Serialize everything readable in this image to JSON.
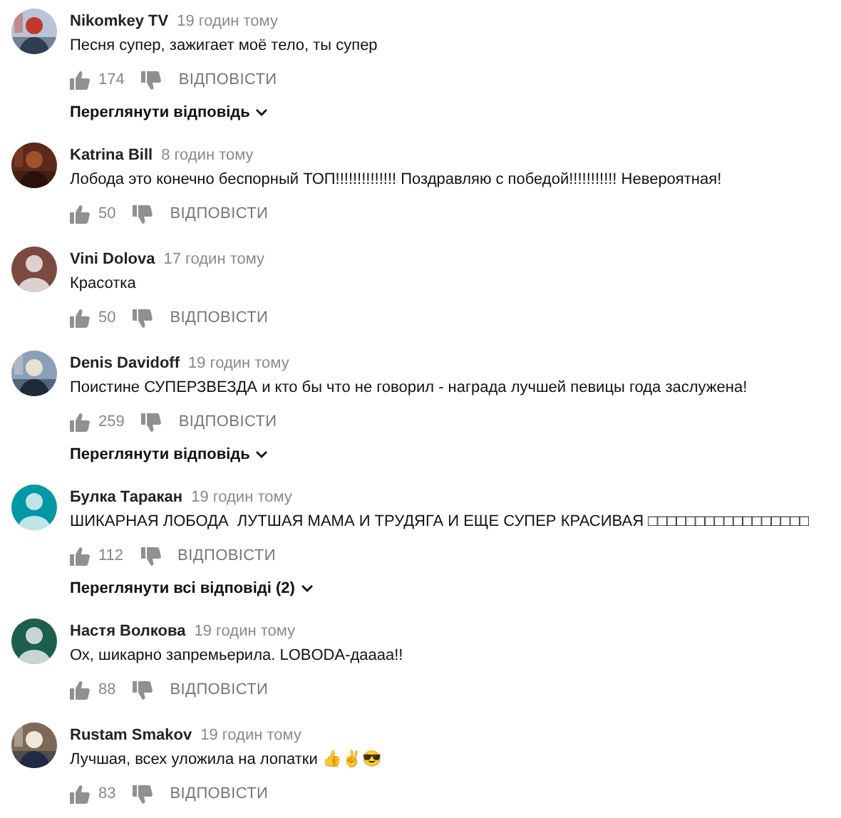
{
  "comments": [
    {
      "author": "Nikomkey TV",
      "time": "19 годин тому",
      "text": "Песня супер, зажигает моё тело, ты супер",
      "likes": "174",
      "reply_label": "ВІДПОВІСТИ",
      "replies_link": "Переглянути відповідь"
    },
    {
      "author": "Katrina Bill",
      "time": "8 годин тому",
      "text": "Лобода это конечно беспорный ТОП!!!!!!!!!!!!!! Поздравляю с победой!!!!!!!!!!! Невероятная!",
      "likes": "50",
      "reply_label": "ВІДПОВІСТИ"
    },
    {
      "author": "Vini Dolova",
      "time": "17 годин тому",
      "text": "Красотка",
      "likes": "50",
      "reply_label": "ВІДПОВІСТИ",
      "avatar": {
        "kind": "default",
        "color": "#7a4a40"
      }
    },
    {
      "author": "Denis Davidoff",
      "time": "19 годин тому",
      "text": "Поистине СУПЕРЗВЕЗДА и кто бы что не говорил - награда лучшей певицы года заслужена!",
      "likes": "259",
      "reply_label": "ВІДПОВІСТИ",
      "replies_link": "Переглянути відповідь"
    },
    {
      "author": "Булка Таракан",
      "time": "19 годин тому",
      "text": "ШИКАРНАЯ ЛОБОДА  ЛУТШАЯ МАМА И ТРУДЯГА И ЕЩЕ СУПЕР КРАСИВАЯ □□□□□□□□□□□□□□□□□",
      "likes": "112",
      "reply_label": "ВІДПОВІСТИ",
      "avatar": {
        "kind": "default",
        "color": "#0097a7"
      },
      "replies_link": "Переглянути всі відповіді (2)"
    },
    {
      "author": "Настя Волкова",
      "time": "19 годин тому",
      "text": "Ох, шикарно запремьерила. LOBODA-даааа!!",
      "likes": "88",
      "reply_label": "ВІДПОВІСТИ",
      "avatar": {
        "kind": "default",
        "color": "#1e5e4c"
      }
    },
    {
      "author": "Rustam Smakov",
      "time": "19 годин тому",
      "text": "Лучшая, всех уложила на лопатки 👍✌😎",
      "likes": "83",
      "reply_label": "ВІДПОВІСТИ"
    }
  ]
}
